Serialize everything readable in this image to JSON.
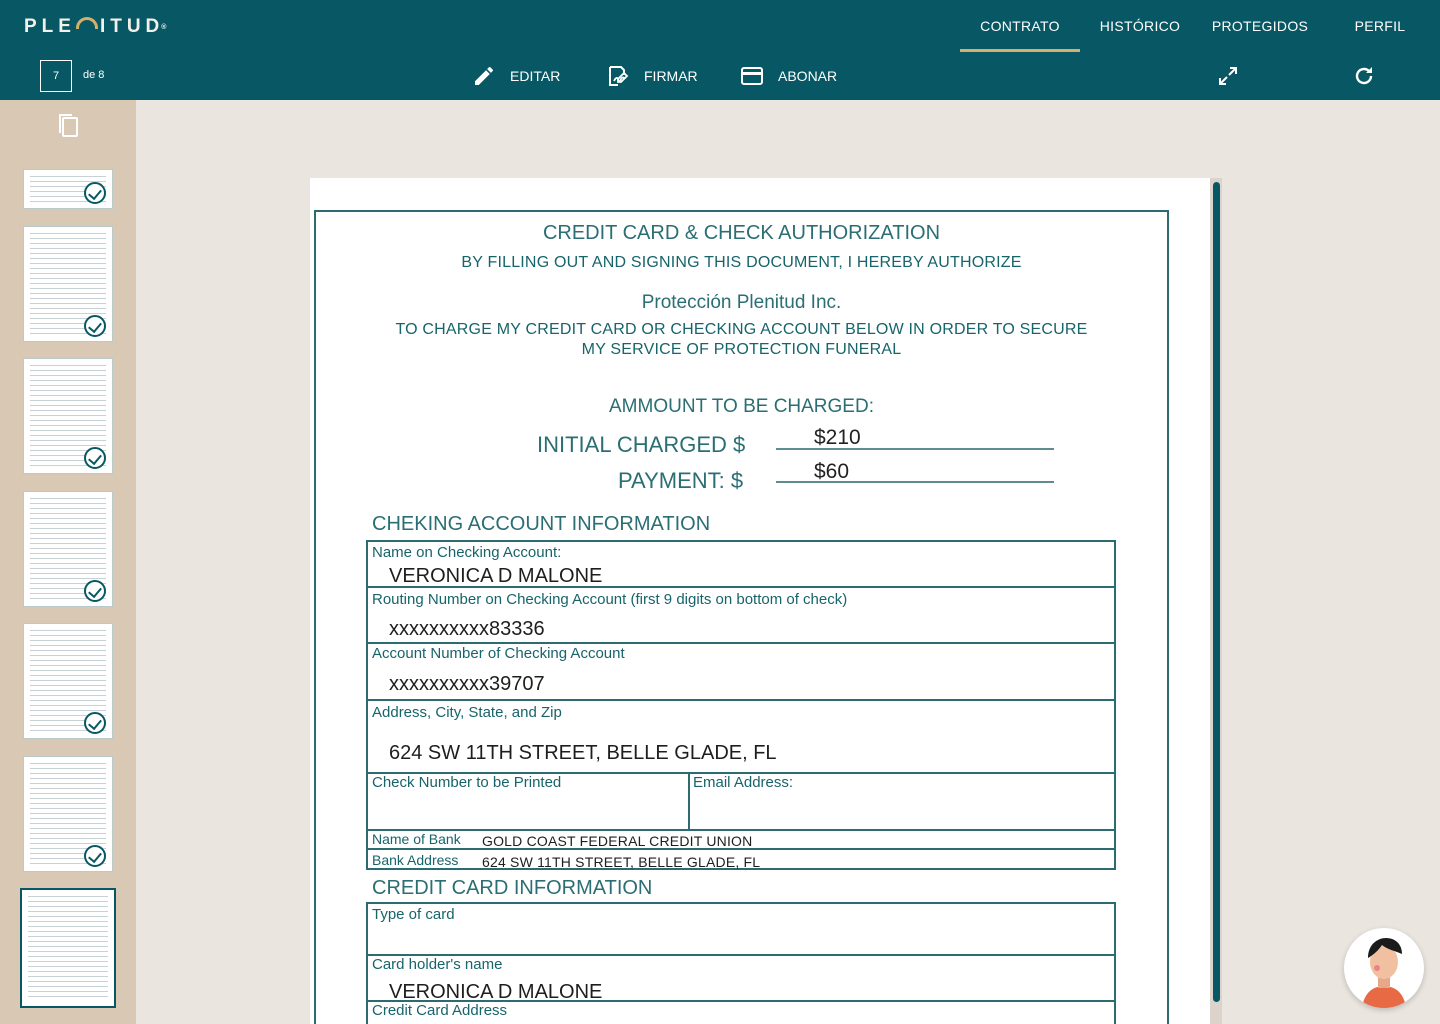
{
  "header": {
    "logo": "PLE   ITUD",
    "logo_mark": "®",
    "nav": [
      {
        "label": "CONTRATO",
        "active": true
      },
      {
        "label": "HISTÓRICO",
        "active": false
      },
      {
        "label": "PROTEGIDOS",
        "active": false
      },
      {
        "label": "PERFIL",
        "active": false
      }
    ],
    "page_current": "7",
    "page_total": "de 8",
    "toolbar": {
      "edit_label": "EDITAR",
      "sign_label": "FIRMAR",
      "pay_label": "ABONAR"
    },
    "accent_color": "#075864",
    "underline_color": "#d4b06a"
  },
  "sidebar": {
    "thumbnails_count": 7,
    "selected_page": 7
  },
  "document": {
    "title": "CREDIT CARD & CHECK AUTHORIZATION",
    "subtitle": "BY FILLING OUT AND SIGNING THIS DOCUMENT, I HEREBY AUTHORIZE",
    "company": "Protección Plenitud Inc.",
    "purpose_line1": "TO CHARGE MY CREDIT CARD OR CHECKING ACCOUNT BELOW IN ORDER TO SECURE",
    "purpose_line2": "MY SERVICE OF PROTECTION FUNERAL",
    "amount_heading": "AMMOUNT TO BE CHARGED:",
    "initial_label": "INITIAL CHARGED $",
    "initial_value": "$210",
    "payment_label": "PAYMENT: $",
    "payment_value": "$60",
    "checking_title": "CHEKING ACCOUNT INFORMATION",
    "name_label": "Name on Checking Account:",
    "name_value": "VERONICA D MALONE",
    "routing_label": "Routing Number on Checking Account (first 9 digits on bottom of check)",
    "routing_value": "xxxxxxxxxx83336",
    "account_label": "Account Number of Checking Account",
    "account_value": "xxxxxxxxxx39707",
    "address_label": "Address, City, State, and Zip",
    "address_value": "624 SW 11TH STREET, BELLE GLADE, FL",
    "check_number_label": "Check Number to be Printed",
    "email_label": "Email Address:",
    "bank_name_label": "Name of Bank",
    "bank_name_value": "GOLD COAST FEDERAL CREDIT UNION",
    "bank_address_label": "Bank Address",
    "bank_address_value": "624 SW 11TH STREET, BELLE GLADE, FL",
    "credit_title": "CREDIT CARD INFORMATION",
    "card_type_label": "Type of card",
    "card_holder_label": "Card holder's name",
    "card_holder_value": "VERONICA D MALONE",
    "card_address_label": "Credit Card Address"
  }
}
